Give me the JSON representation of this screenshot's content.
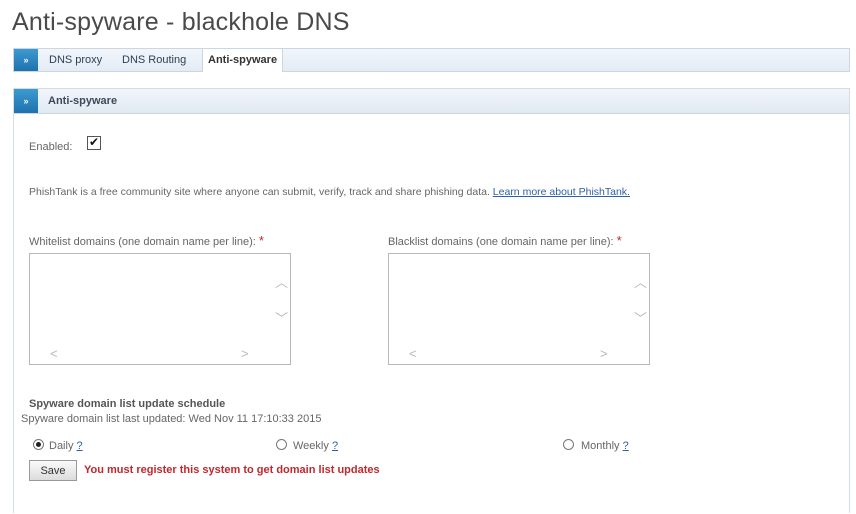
{
  "page": {
    "title": "Anti-spyware - blackhole DNS"
  },
  "tabs": [
    {
      "label": "DNS proxy",
      "active": false
    },
    {
      "label": "DNS Routing",
      "active": false
    },
    {
      "label": "Anti-spyware",
      "active": true
    }
  ],
  "chevron": "»",
  "panel": {
    "title": "Anti-spyware",
    "enabled_label": "Enabled:",
    "enabled_checked": true,
    "description": "PhishTank is a free community site where anyone can submit, verify, track and share phishing data.",
    "learn_more_link": "Learn more about PhishTank.",
    "required_marker": "*",
    "whitelist": {
      "label": "Whitelist domains (one domain name per line):",
      "value": ""
    },
    "blacklist": {
      "label": "Blacklist domains (one domain name per line):",
      "value": ""
    },
    "schedule": {
      "heading": "Spyware domain list update schedule",
      "last_updated": "Spyware domain list last updated: Wed Nov 11 17:10:33 2015",
      "options": [
        {
          "label": "Daily",
          "help": "?",
          "selected": true
        },
        {
          "label": "Weekly",
          "help": "?",
          "selected": false
        },
        {
          "label": "Monthly",
          "help": "?",
          "selected": false
        }
      ]
    },
    "save_label": "Save",
    "warning": "You must register this system to get domain list updates"
  },
  "colors": {
    "accent": "#2a82c0",
    "warning": "#c0282d",
    "link": "#2f5fa5"
  },
  "icons": {
    "chevron": "double-chevron-right-icon",
    "check": "check-icon"
  }
}
